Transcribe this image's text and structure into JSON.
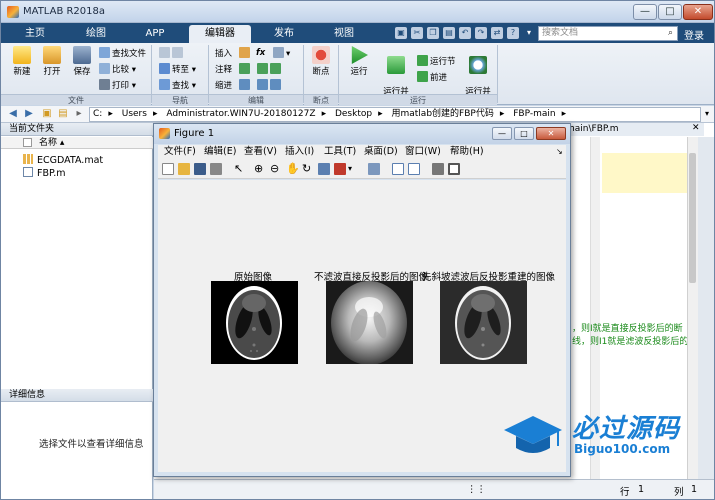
{
  "window": {
    "title": "MATLAB R2018a",
    "min": "—",
    "max": "□",
    "close": "✕"
  },
  "tabs": [
    {
      "label": "主页"
    },
    {
      "label": "绘图"
    },
    {
      "label": "APP"
    },
    {
      "label": "编辑器",
      "active": true
    },
    {
      "label": "发布"
    },
    {
      "label": "视图"
    }
  ],
  "search": {
    "placeholder": "搜索文档",
    "icon": "search-icon"
  },
  "login": "登录",
  "ribbon": {
    "file": {
      "label": "文件",
      "new": "新建",
      "open": "打开",
      "save": "保存",
      "find_files": "查找文件",
      "compare": "比较",
      "print": "打印"
    },
    "navigate": {
      "label": "导航",
      "goto": "转至",
      "find": "查找"
    },
    "edit": {
      "label": "编辑",
      "insert": "插入",
      "comment": "注释",
      "indent": "缩进",
      "fx": "fx"
    },
    "breakpoints": {
      "label": "断点",
      "breakpoint": "断点"
    },
    "run": {
      "label": "运行",
      "run": "运行",
      "run_advance": "运行并\n前进",
      "run_section": "运行节",
      "advance": "前进",
      "run_time": "运行并\n计时"
    }
  },
  "address": {
    "segments": [
      "C:",
      "Users",
      "Administrator.WIN7U-20180127Z",
      "Desktop",
      "用matlab创建的FBP代码",
      "FBP-main"
    ],
    "separator": "▸"
  },
  "current_folder": {
    "title": "当前文件夹",
    "column": "名称",
    "files": [
      {
        "name": "ECGDATA.mat",
        "icon": "mat-file-icon"
      },
      {
        "name": "FBP.m",
        "icon": "m-file-icon"
      }
    ]
  },
  "details": {
    "title": "详细信息",
    "message": "选择文件以查看详细信息"
  },
  "editor": {
    "tab": "main\\FBP.m",
    "comment_lines": [
      "，则I就是直接反投影后的断",
      "线，则I1就是滤波反投影后的"
    ]
  },
  "status": {
    "row_label": "行",
    "row": "1",
    "col_label": "列",
    "col": "1"
  },
  "figure": {
    "title": "Figure 1",
    "menu": [
      "文件(F)",
      "编辑(E)",
      "查看(V)",
      "插入(I)",
      "工具(T)",
      "桌面(D)",
      "窗口(W)",
      "帮助(H)"
    ],
    "subplots": [
      {
        "title": "原始图像"
      },
      {
        "title": "不滤波直接反投影后的图像"
      },
      {
        "title": "先斜坡滤波后反投影重建的图像"
      }
    ]
  },
  "watermark": {
    "text": "必过源码",
    "url": "Biguo100.com"
  }
}
